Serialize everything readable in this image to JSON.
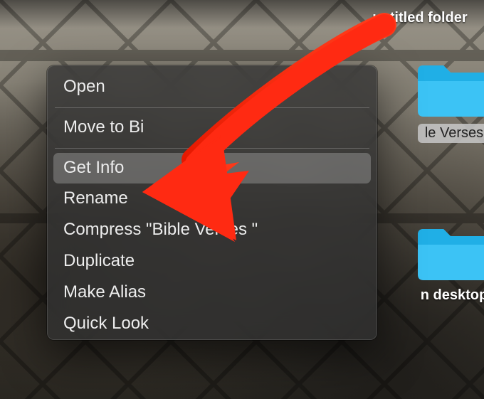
{
  "desktop": {
    "folders": {
      "untitled": {
        "label": "untitled folder"
      },
      "bible_verses": {
        "label": "le Verses"
      },
      "bottom": {
        "label": "n desktop"
      }
    }
  },
  "context_menu": {
    "open": "Open",
    "move_to_bin": "Move to Bi",
    "get_info": "Get Info",
    "rename": "Rename",
    "compress": "Compress \"Bible Verses \"",
    "duplicate": "Duplicate",
    "make_alias": "Make Alias",
    "quick_look": "Quick Look"
  },
  "annotation": {
    "color": "#ff2a12"
  }
}
